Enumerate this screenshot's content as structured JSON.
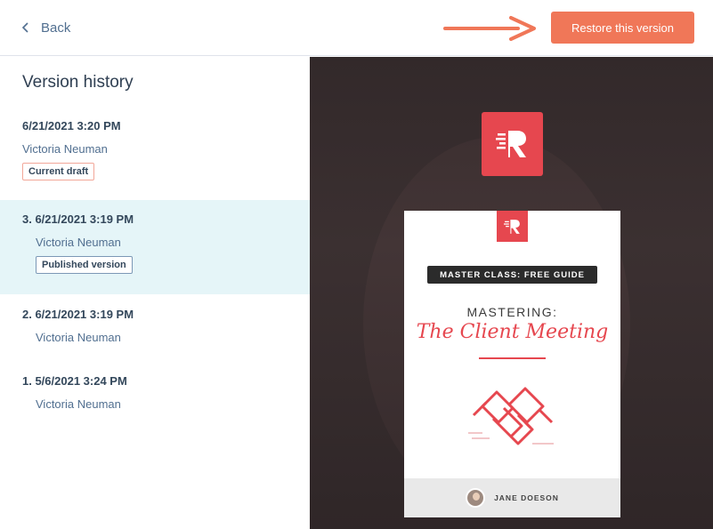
{
  "header": {
    "back_label": "Back",
    "restore_label": "Restore this version",
    "accent_color": "#f07758"
  },
  "sidebar": {
    "title": "Version history",
    "versions": [
      {
        "date": "6/21/2021 3:20 PM",
        "author": "Victoria Neuman",
        "badge": "Current draft"
      },
      {
        "date": "3. 6/21/2021 3:19 PM",
        "author": "Victoria Neuman",
        "badge": "Published version",
        "selected": true
      },
      {
        "date": "2. 6/21/2021 3:19 PM",
        "author": "Victoria Neuman"
      },
      {
        "date": "1. 5/6/2021 3:24 PM",
        "author": "Victoria Neuman"
      }
    ]
  },
  "preview": {
    "tag": "MASTER CLASS: FREE GUIDE",
    "subtitle": "MASTERING:",
    "title": "The Client Meeting",
    "author": "JANE DOESON",
    "brand_color": "#e6474f"
  }
}
